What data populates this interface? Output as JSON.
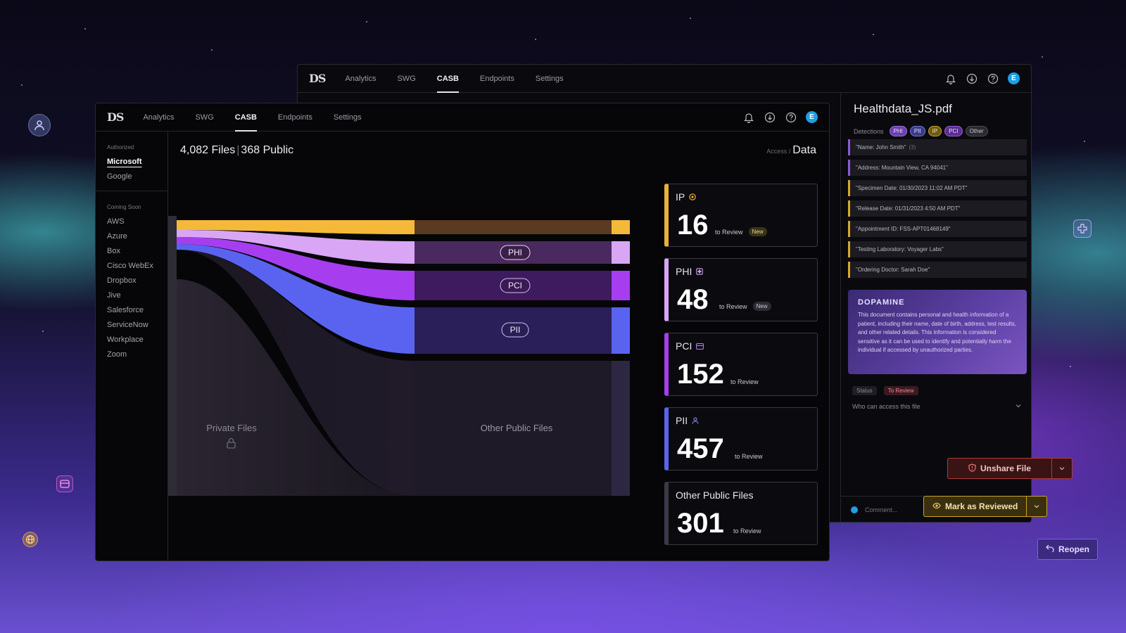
{
  "nav": {
    "logo": "DS",
    "tabs": [
      "Analytics",
      "SWG",
      "CASB",
      "Endpoints",
      "Settings"
    ],
    "active_tab": "CASB",
    "avatar_initial": "E"
  },
  "sidebar": {
    "section_authorized": "Authorized",
    "authorized": [
      "Microsoft",
      "Google"
    ],
    "active": "Microsoft",
    "section_coming_soon": "Coming Soon",
    "coming_soon": [
      "AWS",
      "Azure",
      "Box",
      "Cisco WebEx",
      "Dropbox",
      "Jive",
      "Salesforce",
      "ServiceNow",
      "Workplace",
      "Zoom"
    ]
  },
  "main": {
    "files_count": "4,082 Files",
    "public_count": "368 Public",
    "breadcrumb_parent": "Access /",
    "breadcrumb_current": "Data"
  },
  "sankey": {
    "flow_labels": [
      "PHI",
      "PCI",
      "PII"
    ],
    "private_label": "Private Files",
    "other_public_label": "Other Public Files",
    "colors": {
      "ip": "#f5b93a",
      "phi": "#d9a6f6",
      "pci": "#a63ef0",
      "pii": "#5a63f0"
    }
  },
  "cards": [
    {
      "name": "IP",
      "count": "16",
      "review": "to Review",
      "badge": "New",
      "color": "#e8b23a",
      "icon": "ip-icon"
    },
    {
      "name": "PHI",
      "count": "48",
      "review": "to Review",
      "badge": "New",
      "color": "#d9a6f6",
      "icon": "medical-icon"
    },
    {
      "name": "PCI",
      "count": "152",
      "review": "to Review",
      "badge": "",
      "color": "#a63ef0",
      "icon": "card-icon"
    },
    {
      "name": "PII",
      "count": "457",
      "review": "to Review",
      "badge": "",
      "color": "#5a63f0",
      "icon": "person-icon"
    },
    {
      "name": "Other Public Files",
      "count": "301",
      "review": "to Review",
      "badge": "",
      "color": "#3a3a48",
      "icon": ""
    }
  ],
  "detail": {
    "title": "Healthdata_JS.pdf",
    "detections_label": "Detections",
    "tags": [
      "PHI",
      "PII",
      "IP",
      "PCI",
      "Other"
    ],
    "items": [
      {
        "text": "\"Name: John Smith\"",
        "extra": "(3)",
        "kind": "phi"
      },
      {
        "text": "\"Address: Mountain View, CA 94041\"",
        "extra": "",
        "kind": "phi"
      },
      {
        "text": "\"Specimen Date: 01/30/2023 11:02 AM PDT\"",
        "extra": "",
        "kind": "ip"
      },
      {
        "text": "\"Release Date: 01/31/2023 4:50 AM PDT\"",
        "extra": "",
        "kind": "ip"
      },
      {
        "text": "\"Appointment ID: FSS-APT01468149\"",
        "extra": "",
        "kind": "ip"
      },
      {
        "text": "\"Testing Laboratory: Voyager Labs\"",
        "extra": "",
        "kind": "ip"
      },
      {
        "text": "\"Ordering Doctor: Sarah Doe\"",
        "extra": "",
        "kind": "ip"
      }
    ],
    "ai_brand": "DOPAMINE",
    "ai_text": "This document contains personal and health information of a patient, including their name, date of birth, address, test results, and other related details. This information is considered sensitive as it can be used to identify and potentially harm the individual if accessed by unauthorized parties.",
    "status_label": "Status",
    "status_value": "To Review",
    "access_label": "Who can access this file",
    "comment_placeholder": "Comment..."
  },
  "actions": {
    "unshare": "Unshare File",
    "mark_reviewed": "Mark as Reviewed",
    "reopen": "Reopen"
  }
}
